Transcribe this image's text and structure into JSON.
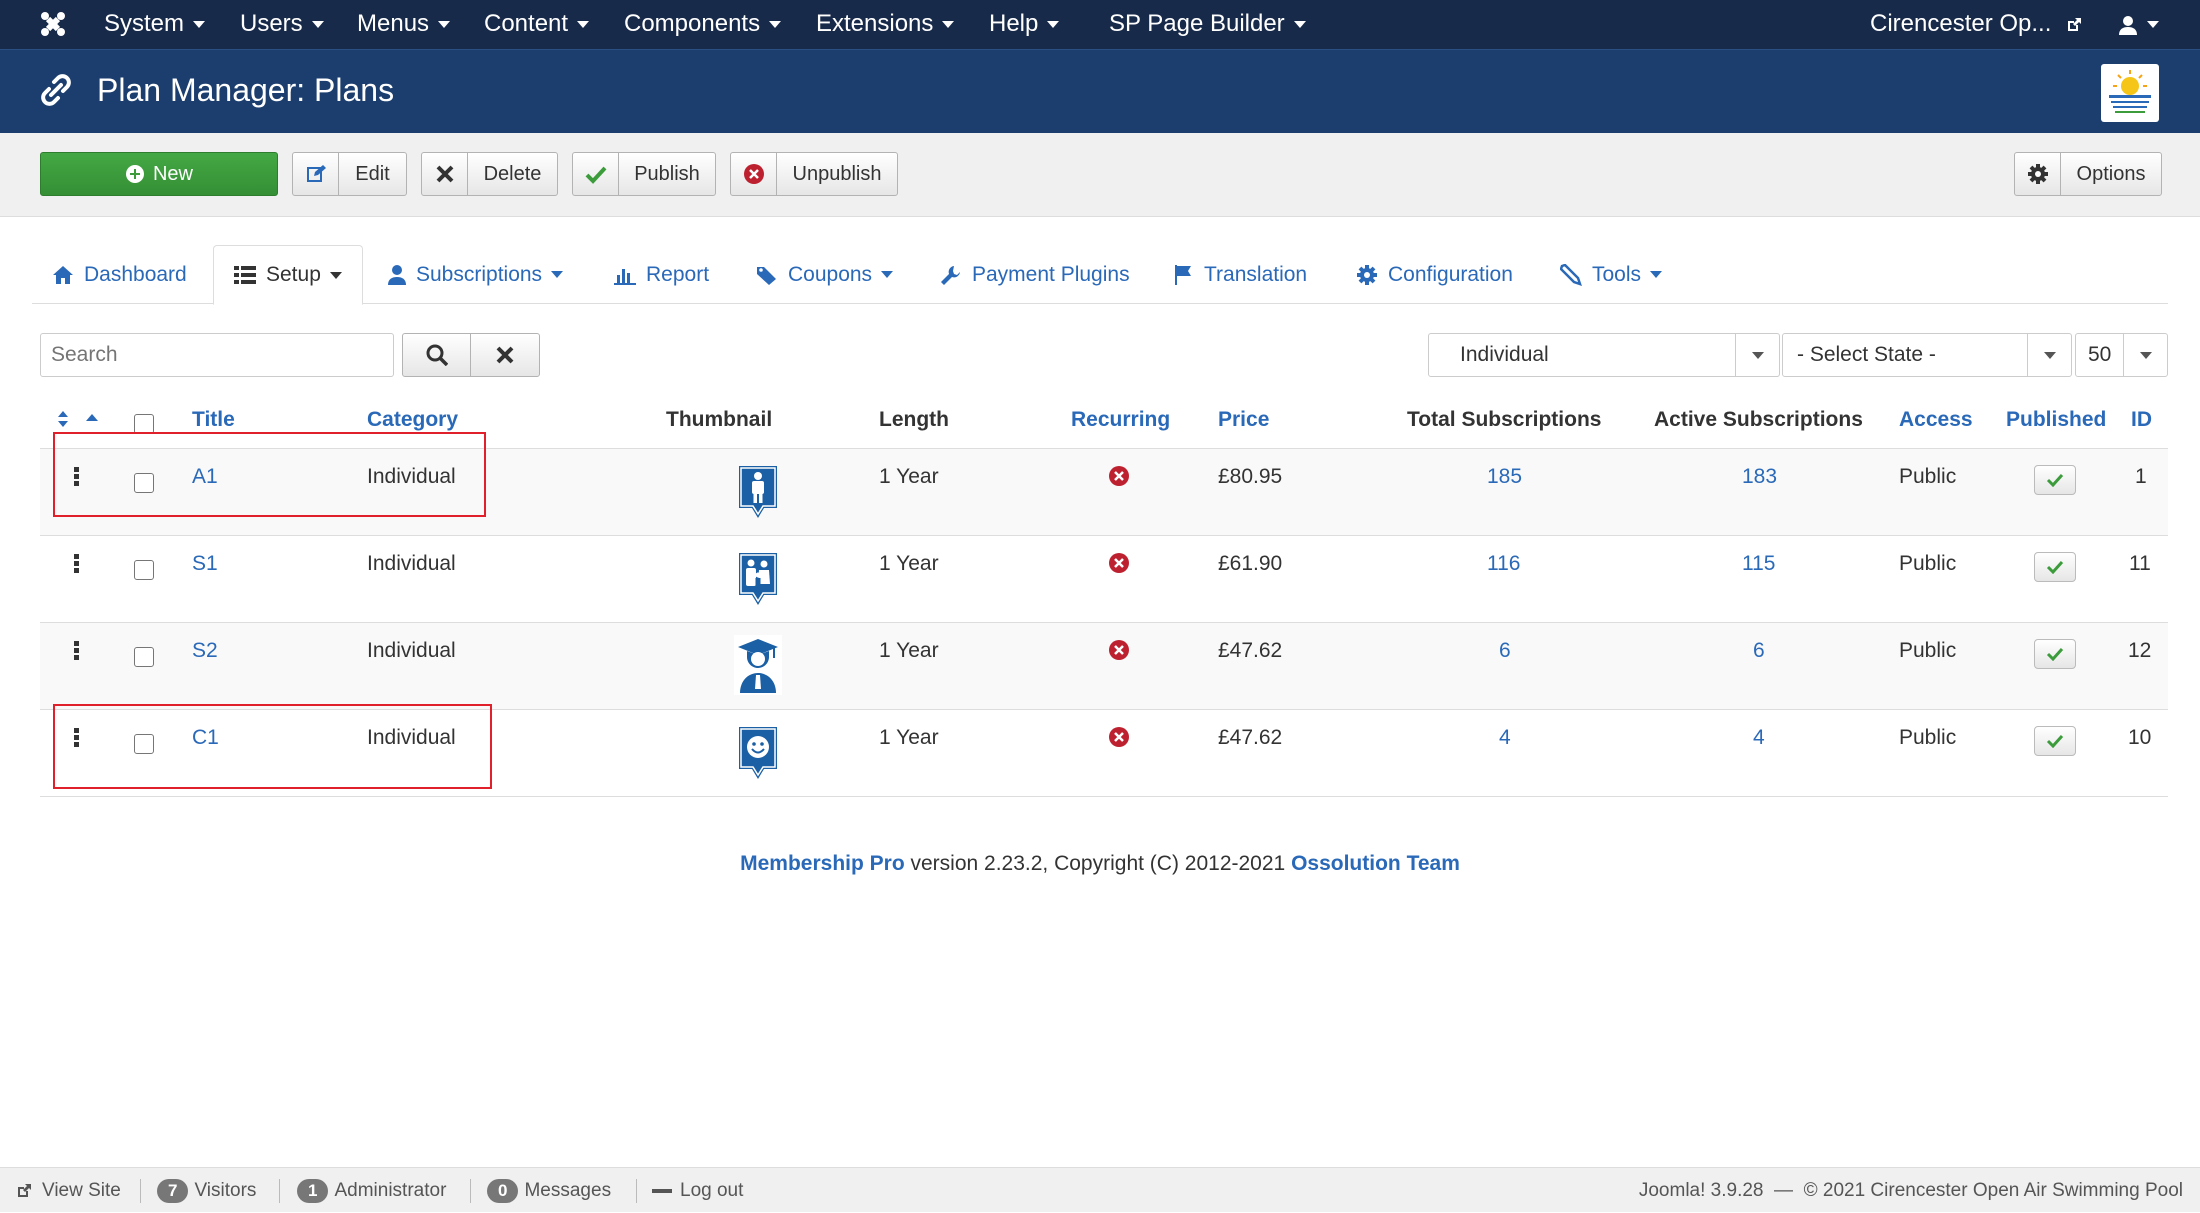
{
  "topnav": {
    "items": [
      {
        "label": "System"
      },
      {
        "label": "Users"
      },
      {
        "label": "Menus"
      },
      {
        "label": "Content"
      },
      {
        "label": "Components"
      },
      {
        "label": "Extensions"
      },
      {
        "label": "Help"
      },
      {
        "label": "SP Page Builder"
      }
    ],
    "site_label": "Cirencester Op..."
  },
  "header": {
    "title": "Plan Manager: Plans"
  },
  "toolbar": {
    "new_label": "New",
    "edit_label": "Edit",
    "delete_label": "Delete",
    "publish_label": "Publish",
    "unpublish_label": "Unpublish",
    "options_label": "Options"
  },
  "tabs": [
    {
      "label": "Dashboard"
    },
    {
      "label": "Setup"
    },
    {
      "label": "Subscriptions"
    },
    {
      "label": "Report"
    },
    {
      "label": "Coupons"
    },
    {
      "label": "Payment Plugins"
    },
    {
      "label": "Translation"
    },
    {
      "label": "Configuration"
    },
    {
      "label": "Tools"
    }
  ],
  "filters": {
    "search_placeholder": "Search",
    "category_value": "Individual",
    "state_value": "- Select State -",
    "limit_value": "50"
  },
  "table": {
    "headers": {
      "title": "Title",
      "category": "Category",
      "thumbnail": "Thumbnail",
      "length": "Length",
      "recurring": "Recurring",
      "price": "Price",
      "total": "Total Subscriptions",
      "active": "Active Subscriptions",
      "access": "Access",
      "published": "Published",
      "id": "ID"
    },
    "rows": [
      {
        "title": "A1",
        "category": "Individual",
        "thumb": "person-standing-icon",
        "length": "1 Year",
        "price": "£80.95",
        "total": "185",
        "active": "183",
        "access": "Public",
        "id": "1"
      },
      {
        "title": "S1",
        "category": "Individual",
        "thumb": "family-icon",
        "length": "1 Year",
        "price": "£61.90",
        "total": "116",
        "active": "115",
        "access": "Public",
        "id": "11"
      },
      {
        "title": "S2",
        "category": "Individual",
        "thumb": "graduate-icon",
        "length": "1 Year",
        "price": "£47.62",
        "total": "6",
        "active": "6",
        "access": "Public",
        "id": "12"
      },
      {
        "title": "C1",
        "category": "Individual",
        "thumb": "smiley-icon",
        "length": "1 Year",
        "price": "£47.62",
        "total": "4",
        "active": "4",
        "access": "Public",
        "id": "10"
      }
    ]
  },
  "footer": {
    "product": "Membership Pro",
    "middle": " version 2.23.2, Copyright (C) 2012-2021 ",
    "team": "Ossolution Team"
  },
  "statusbar": {
    "view_site": "View Site",
    "visitors_count": "7",
    "visitors_label": "Visitors",
    "admin_count": "1",
    "admin_label": "Administrator",
    "messages_count": "0",
    "messages_label": "Messages",
    "logout": "Log out",
    "version": "Joomla! 3.9.28  —  © 2021 Cirencester Open Air Swimming Pool"
  },
  "colors": {
    "topnav_bg": "#182a4a",
    "header_bg": "#1b3e6e",
    "new_button": "#3c9c3c",
    "link": "#2a69b8",
    "unpublished_red": "#bd2130",
    "published_green": "#3c9c3c",
    "highlight": "#e0202a"
  }
}
